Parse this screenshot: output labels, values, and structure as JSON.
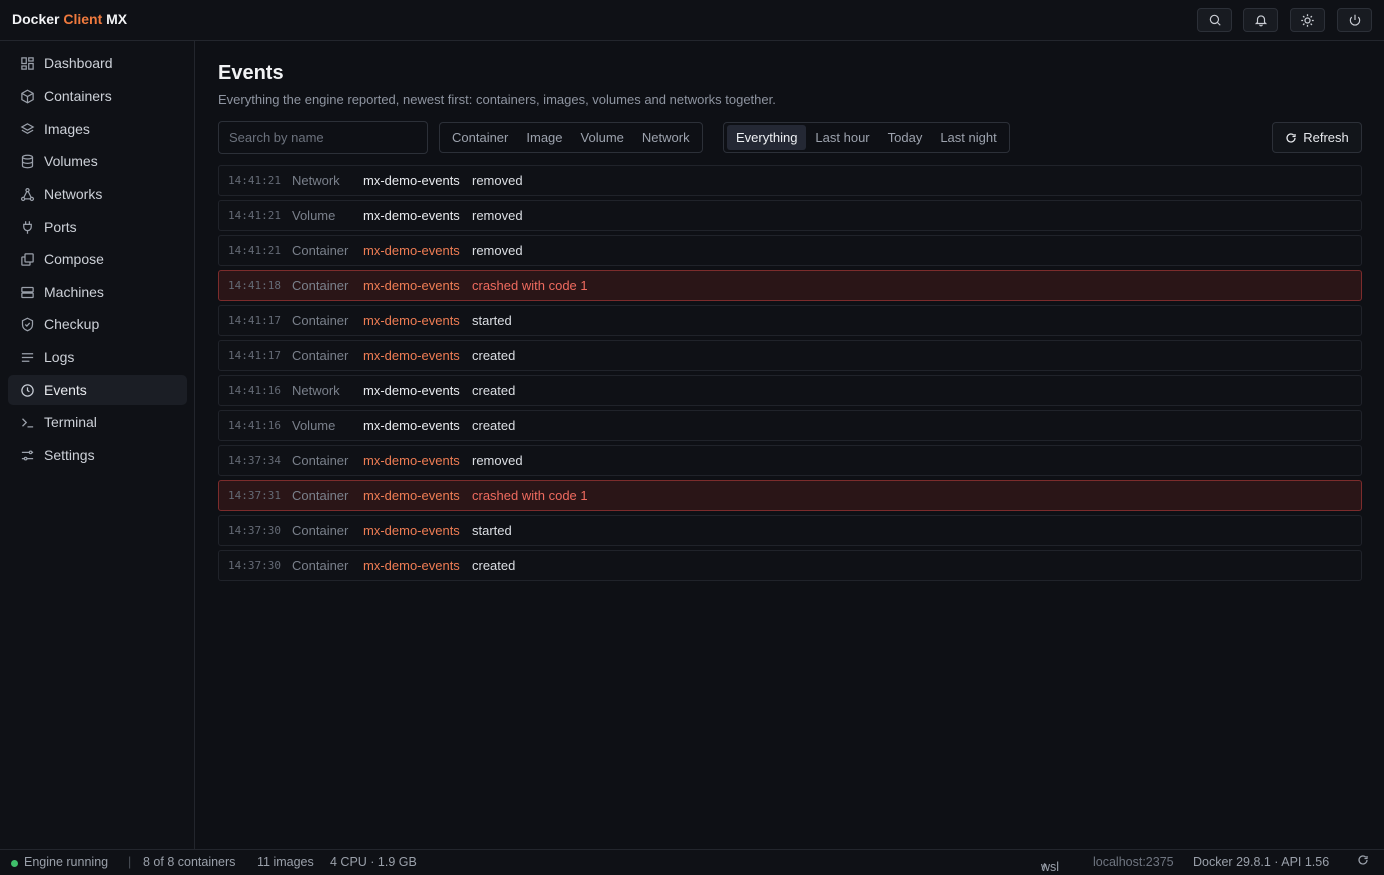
{
  "app": {
    "brand_1": "Docker",
    "brand_2": "Client",
    "brand_3": "MX"
  },
  "colors": {
    "accent": "#f07a3e",
    "crash": "#ef6b5f",
    "running": "#3fbf6a"
  },
  "topbar": {
    "icons": [
      "search-icon",
      "bell-icon",
      "sun-icon",
      "power-icon"
    ]
  },
  "sidebar": {
    "items": [
      {
        "label": "Dashboard",
        "icon": "dashboard-icon"
      },
      {
        "label": "Containers",
        "icon": "cube-icon"
      },
      {
        "label": "Images",
        "icon": "layers-icon"
      },
      {
        "label": "Volumes",
        "icon": "database-icon"
      },
      {
        "label": "Networks",
        "icon": "network-icon"
      },
      {
        "label": "Ports",
        "icon": "plug-icon"
      },
      {
        "label": "Compose",
        "icon": "compose-icon"
      },
      {
        "label": "Machines",
        "icon": "server-icon"
      },
      {
        "label": "Checkup",
        "icon": "shield-check-icon"
      },
      {
        "label": "Logs",
        "icon": "lines-icon"
      },
      {
        "label": "Events",
        "icon": "clock-icon",
        "active": true
      },
      {
        "label": "Terminal",
        "icon": "terminal-icon"
      },
      {
        "label": "Settings",
        "icon": "sliders-icon"
      }
    ]
  },
  "main": {
    "title": "Events",
    "subtitle": "Everything the engine reported, newest first: containers, images, volumes and networks together.",
    "search_placeholder": "Search by name",
    "type_filters": [
      "Container",
      "Image",
      "Volume",
      "Network"
    ],
    "time_filters": [
      "Everything",
      "Last hour",
      "Today",
      "Last night"
    ],
    "time_filter_selected": "Everything",
    "refresh_label": "Refresh"
  },
  "events": [
    {
      "time": "14:41:21",
      "kind": "Network",
      "name": "mx-demo-events",
      "action": "removed",
      "crash": false
    },
    {
      "time": "14:41:21",
      "kind": "Volume",
      "name": "mx-demo-events",
      "action": "removed",
      "crash": false
    },
    {
      "time": "14:41:21",
      "kind": "Container",
      "name": "mx-demo-events",
      "action": "removed",
      "crash": false
    },
    {
      "time": "14:41:18",
      "kind": "Container",
      "name": "mx-demo-events",
      "action": "crashed with code 1",
      "crash": true
    },
    {
      "time": "14:41:17",
      "kind": "Container",
      "name": "mx-demo-events",
      "action": "started",
      "crash": false
    },
    {
      "time": "14:41:17",
      "kind": "Container",
      "name": "mx-demo-events",
      "action": "created",
      "crash": false
    },
    {
      "time": "14:41:16",
      "kind": "Network",
      "name": "mx-demo-events",
      "action": "created",
      "crash": false
    },
    {
      "time": "14:41:16",
      "kind": "Volume",
      "name": "mx-demo-events",
      "action": "created",
      "crash": false
    },
    {
      "time": "14:37:34",
      "kind": "Container",
      "name": "mx-demo-events",
      "action": "removed",
      "crash": false
    },
    {
      "time": "14:37:31",
      "kind": "Container",
      "name": "mx-demo-events",
      "action": "crashed with code 1",
      "crash": true
    },
    {
      "time": "14:37:30",
      "kind": "Container",
      "name": "mx-demo-events",
      "action": "started",
      "crash": false
    },
    {
      "time": "14:37:30",
      "kind": "Container",
      "name": "mx-demo-events",
      "action": "created",
      "crash": false
    }
  ],
  "status": {
    "engine": "Engine running",
    "containers": "8 of 8 containers",
    "images": "11 images",
    "resources": "4 CPU · 1.9 GB",
    "context": "wsl",
    "host": "localhost:2375",
    "version": "Docker 29.8.1 · API 1.56"
  }
}
